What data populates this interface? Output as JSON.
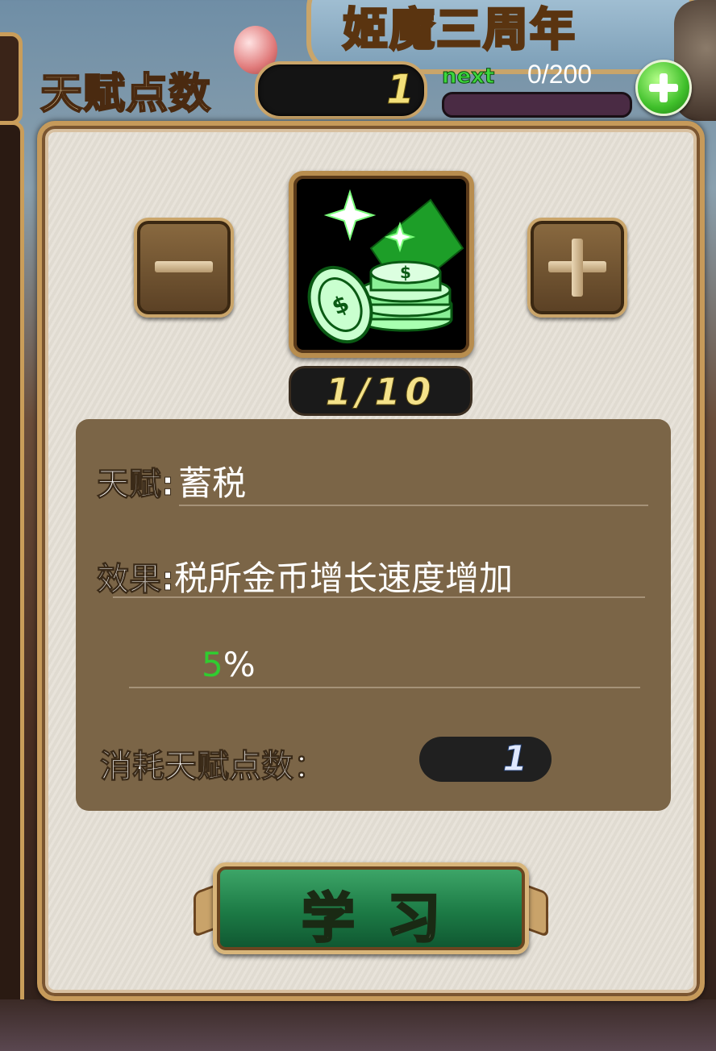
{
  "background": {
    "event_title": "姬魔三周年"
  },
  "topbar": {
    "talent_points_label": "天赋点数",
    "talent_points_value": "1",
    "next_label": "next",
    "next_progress_text": "0/200",
    "next_progress_fraction": 0,
    "add_button_icon": "plus-icon"
  },
  "skill": {
    "icon": "coins-sparkle-icon",
    "level_text": "1/10",
    "decrease_icon": "minus-icon",
    "increase_icon": "plus-icon"
  },
  "info": {
    "talent_label": "天赋:",
    "talent_name": "蓄税",
    "effect_label": "效果:",
    "effect_text": "税所金币增长速度增加",
    "effect_value": "5",
    "effect_unit": "%",
    "cost_label": "消耗天赋点数：",
    "cost_value": "1"
  },
  "actions": {
    "learn_label": "学习"
  },
  "colors": {
    "accent_green": "#30cc30",
    "panel_border": "#c69a5a",
    "info_bg": "#7b6547",
    "level_text": "#f4e28a"
  }
}
